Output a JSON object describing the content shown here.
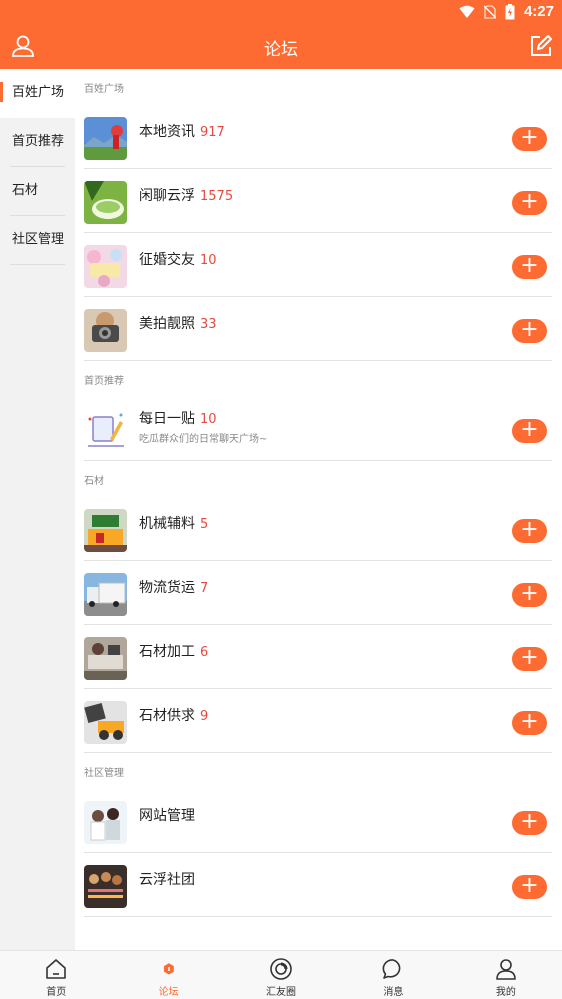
{
  "status_bar": {
    "time": "4:27"
  },
  "header": {
    "title": "论坛",
    "left_icon": "user-icon",
    "right_icon": "edit-icon"
  },
  "sidebar": {
    "items": [
      {
        "label": "百姓广场",
        "active": true
      },
      {
        "label": "首页推荐"
      },
      {
        "label": "石材"
      },
      {
        "label": "社区管理"
      }
    ]
  },
  "sections": [
    {
      "title": "百姓广场",
      "rows": [
        {
          "name": "本地资讯",
          "count": "917"
        },
        {
          "name": "闲聊云浮",
          "count": "1575"
        },
        {
          "name": "征婚交友",
          "count": "10"
        },
        {
          "name": "美拍靓照",
          "count": "33"
        }
      ]
    },
    {
      "title": "首页推荐",
      "rows": [
        {
          "name": "每日一贴",
          "count": "10",
          "desc": "吃瓜群众们的日常聊天广场~"
        }
      ]
    },
    {
      "title": "石材",
      "rows": [
        {
          "name": "机械辅料",
          "count": "5"
        },
        {
          "name": "物流货运",
          "count": "7"
        },
        {
          "name": "石材加工",
          "count": "6"
        },
        {
          "name": "石材供求",
          "count": "9"
        }
      ]
    },
    {
      "title": "社区管理",
      "rows": [
        {
          "name": "网站管理",
          "count": ""
        },
        {
          "name": "云浮社团",
          "count": ""
        }
      ]
    }
  ],
  "add_button": {
    "label": "+"
  },
  "bottom_nav": [
    {
      "label": "首页",
      "icon": "home-icon"
    },
    {
      "label": "论坛",
      "icon": "forum-icon",
      "active": true
    },
    {
      "label": "汇友圈",
      "icon": "moments-icon"
    },
    {
      "label": "消息",
      "icon": "message-icon"
    },
    {
      "label": "我的",
      "icon": "profile-icon"
    }
  ],
  "colors": {
    "accent": "#fe6b32",
    "count": "#e64a3e",
    "sidebar_bg": "#f2f2f2"
  }
}
